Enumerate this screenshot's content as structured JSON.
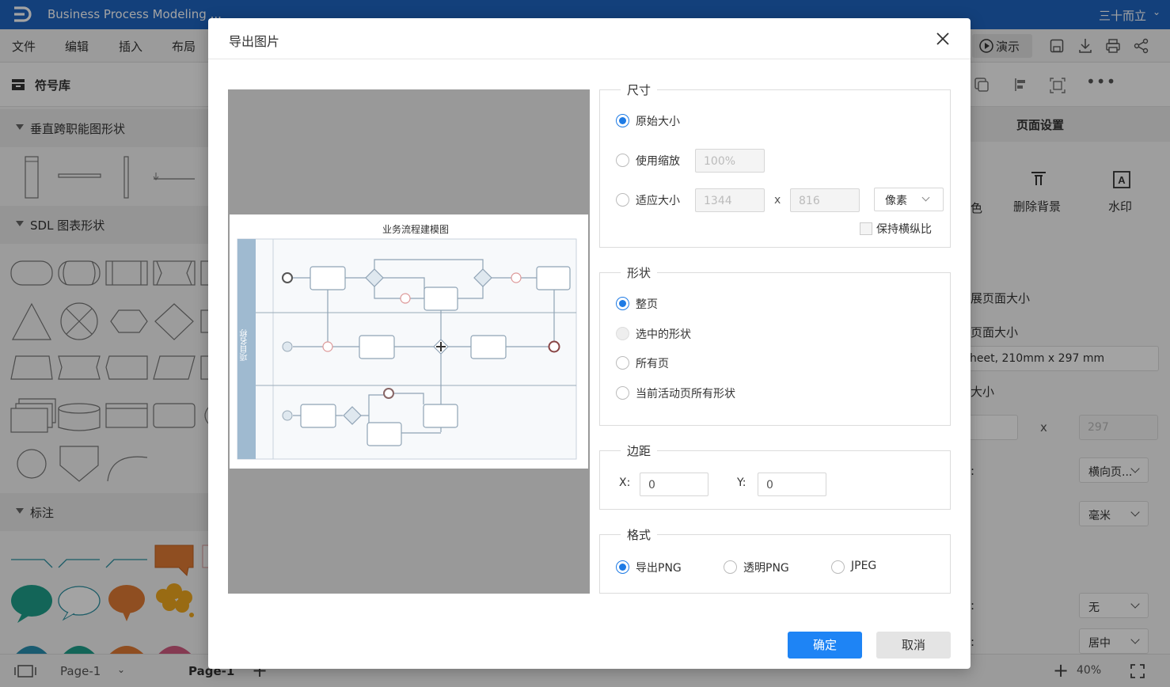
{
  "app": {
    "title": "Business Process Modeling ...",
    "user": "三十而立",
    "menu": [
      "文件",
      "编辑",
      "插入",
      "布局"
    ],
    "toolbar": {
      "present_label": "演示"
    }
  },
  "left_panel": {
    "title": "符号库",
    "sections": [
      "垂直跨职能图形状",
      "SDL 图表形状",
      "标注"
    ]
  },
  "right_panel": {
    "title": "页面设置",
    "bg_partial": "色",
    "delete_bg_label": "删除背景",
    "watermark_label": "水印",
    "expand_label": "展页面大小",
    "page_size_label": "页面大小",
    "page_size_value": "heet, 210mm x 297 mm",
    "custom_size_label": "大小",
    "height_value": "297",
    "x_sep": "x",
    "orientation_value": "横向页...",
    "unit_value": "毫米",
    "colon": ":",
    "row3_value": "无",
    "row4_value": "居中"
  },
  "statusbar": {
    "page_select": "Page-1",
    "page_tab": "Page-1",
    "zoom": "40%"
  },
  "dialog": {
    "title": "导出图片",
    "preview_title": "业务流程建模图",
    "lane_label": "项目名称",
    "size": {
      "label": "尺寸",
      "original": "原始大小",
      "scale": "使用缩放",
      "scale_placeholder": "100%",
      "fit": "适应大小",
      "width_placeholder": "1344",
      "height_placeholder": "816",
      "times": "x",
      "unit": "像素",
      "keep_ratio": "保持横纵比"
    },
    "shape": {
      "label": "形状",
      "whole_page": "整页",
      "selected": "选中的形状",
      "all_pages": "所有页",
      "current_page_shapes": "当前活动页所有形状"
    },
    "margin": {
      "label": "边距",
      "x_label": "X:",
      "x_value": "0",
      "y_label": "Y:",
      "y_value": "0"
    },
    "format": {
      "label": "格式",
      "png": "导出PNG",
      "transparent_png": "透明PNG",
      "jpeg": "JPEG"
    },
    "ok": "确定",
    "cancel": "取消"
  }
}
